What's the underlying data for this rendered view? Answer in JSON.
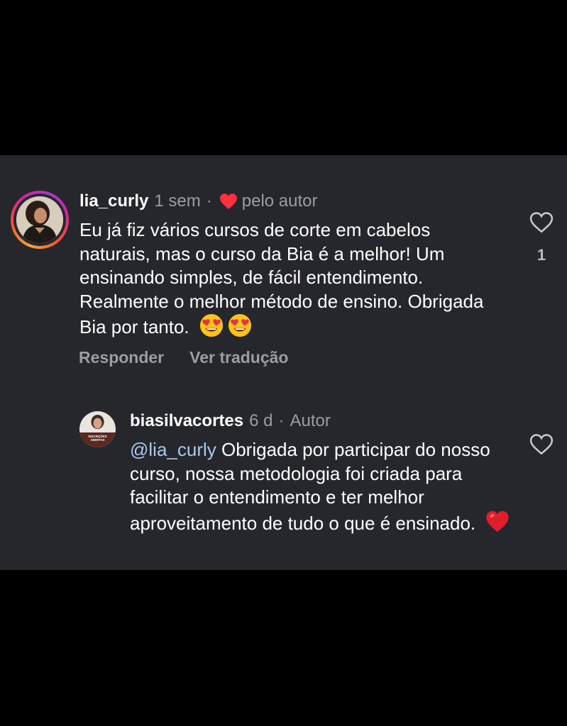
{
  "comments": {
    "main": {
      "username": "lia_curly",
      "time": "1 sem",
      "separator": "·",
      "liked_by_author_label": "pelo autor",
      "text": "Eu já fiz vários cursos de corte em cabelos naturais, mas o curso  da Bia é  a melhor! Um ensinando simples, de fácil entendimento. Realmente o melhor método de ensino. Obrigada Bia por tanto.",
      "emojis": [
        "heart-eyes-emoji",
        "heart-eyes-emoji"
      ],
      "like_count": "1",
      "actions": {
        "reply": "Responder",
        "translate": "Ver tradução"
      }
    },
    "reply": {
      "username": "biasilvacortes",
      "time": "6 d",
      "separator": "·",
      "badge": "Autor",
      "mention": "@lia_curly",
      "text": " Obrigada por participar do nosso curso, nossa metodologia foi criada para facilitar o entendimento e ter melhor aproveitamento de tudo o que é ensinado.",
      "avatar_text": "INSCRIÇÕES ABERTAS",
      "emoji": "red-heart-emoji"
    }
  },
  "colors": {
    "panel_bg": "#25272c",
    "text": "#ffffff",
    "muted": "#9a9da3",
    "mention": "#a9c9f3",
    "heart": "#ff3040"
  }
}
